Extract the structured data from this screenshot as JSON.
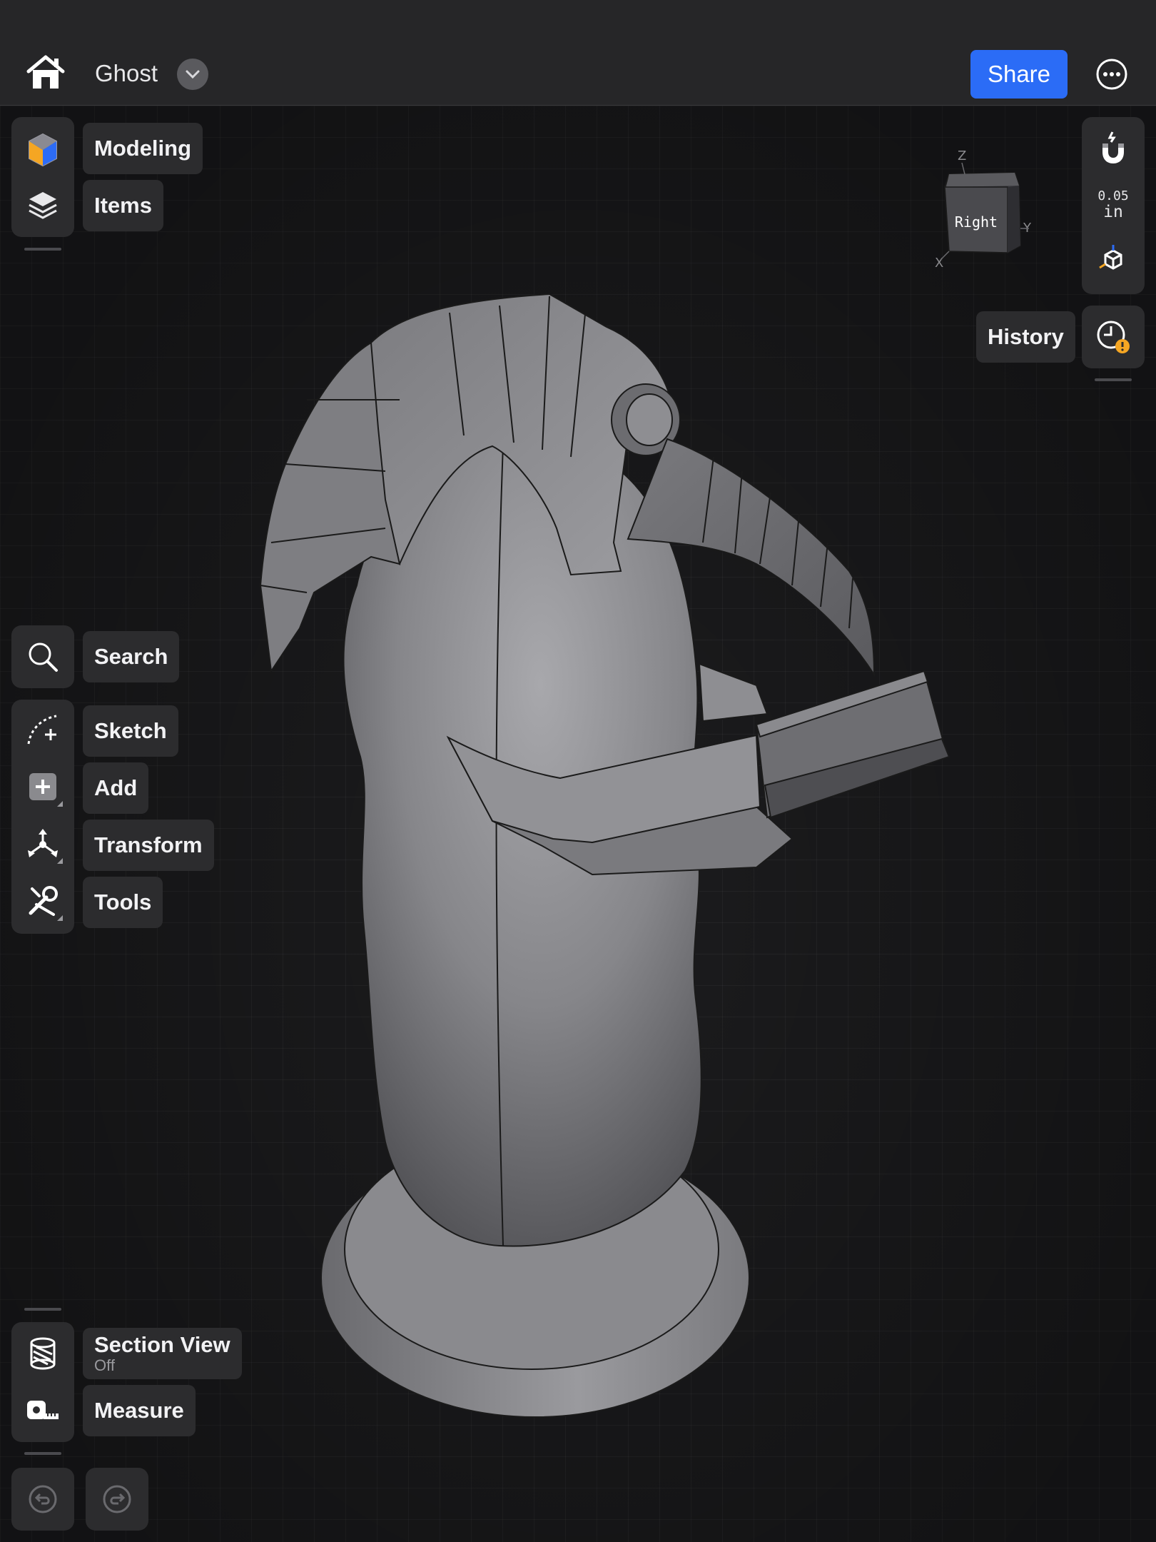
{
  "header": {
    "doc_title": "Ghost",
    "share_label": "Share"
  },
  "left_toolbar": {
    "workspace": [
      {
        "label": "Modeling",
        "icon": "modeling-cube-icon"
      },
      {
        "label": "Items",
        "icon": "layers-icon"
      }
    ],
    "tools": [
      {
        "label": "Search",
        "icon": "search-icon"
      },
      {
        "label": "Sketch",
        "icon": "sketch-icon"
      },
      {
        "label": "Add",
        "icon": "add-icon"
      },
      {
        "label": "Transform",
        "icon": "transform-icon"
      },
      {
        "label": "Tools",
        "icon": "tools-icon"
      }
    ],
    "inspect": {
      "section_view_label": "Section View",
      "section_view_state": "Off",
      "measure_label": "Measure"
    }
  },
  "right_toolbar": {
    "snap_value": "0.05",
    "snap_unit": "in",
    "history_label": "History"
  },
  "viewcube": {
    "face_label": "Right",
    "axis_z": "Z",
    "axis_y": "Y",
    "axis_x": "X"
  },
  "colors": {
    "accent": "#2b6cf6",
    "panel": "#2c2c2e",
    "warning": "#f5a623",
    "background": "#1c1c1e"
  }
}
